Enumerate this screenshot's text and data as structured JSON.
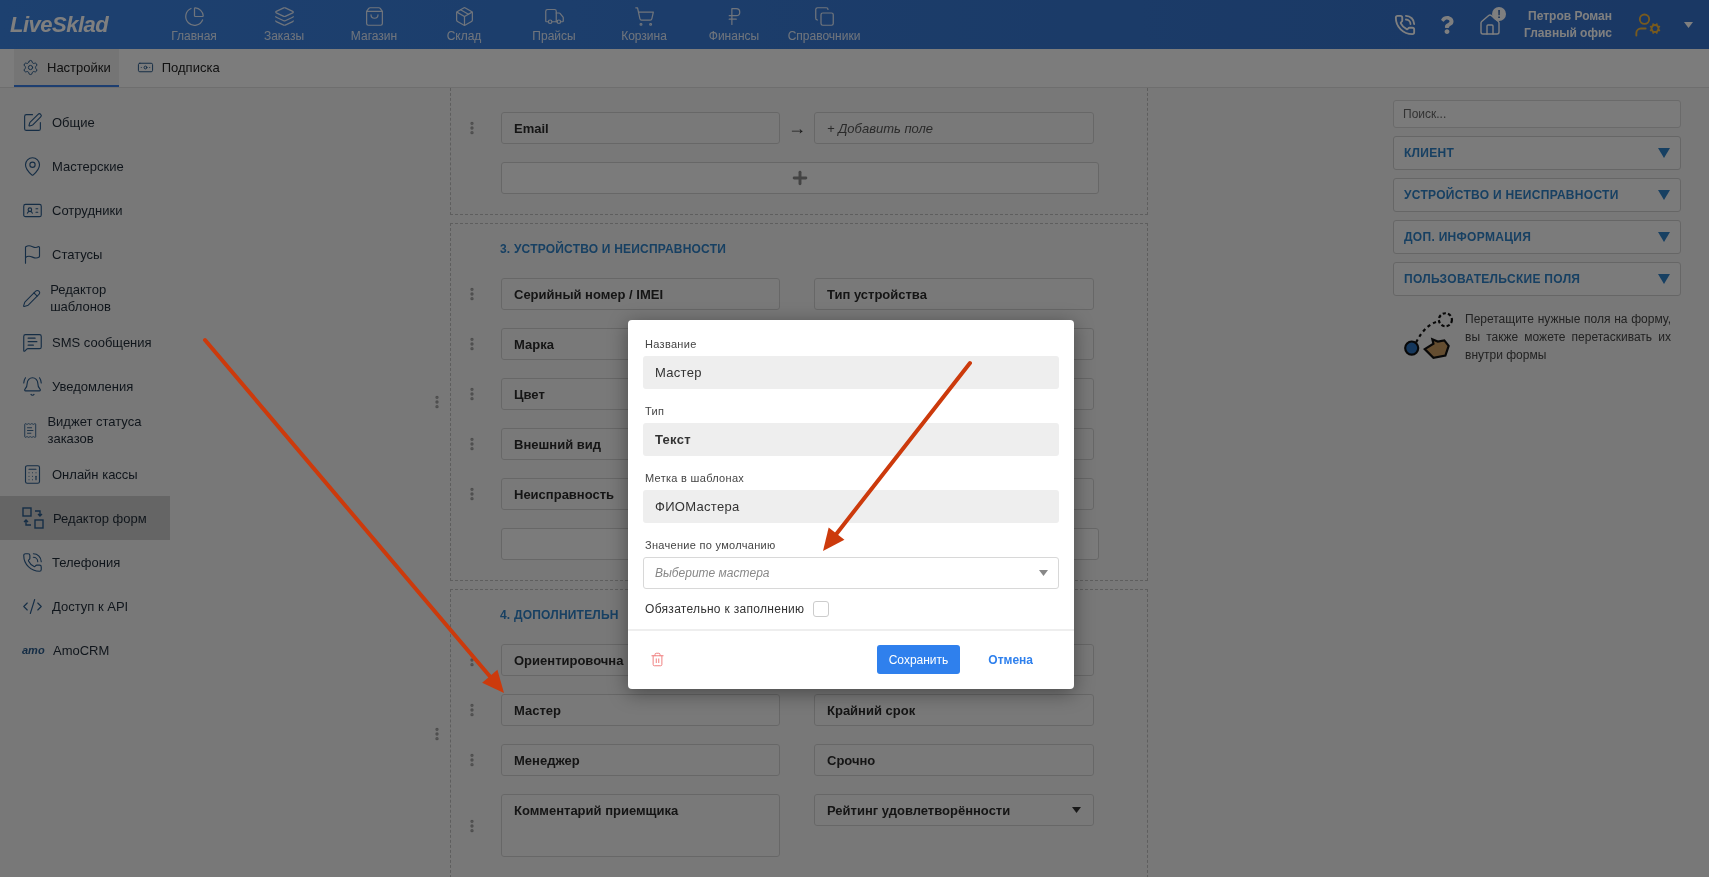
{
  "header": {
    "logo": "LiveSklad",
    "nav": [
      {
        "label": "Главная"
      },
      {
        "label": "Заказы"
      },
      {
        "label": "Магазин"
      },
      {
        "label": "Склад"
      },
      {
        "label": "Прайсы"
      },
      {
        "label": "Корзина"
      },
      {
        "label": "Финансы"
      },
      {
        "label": "Справочники"
      }
    ],
    "notification_badge": "!",
    "user": {
      "name": "Петров Роман",
      "office": "Главный офис"
    }
  },
  "subnav": [
    {
      "label": "Настройки",
      "selected": true
    },
    {
      "label": "Подписка",
      "selected": false
    }
  ],
  "sidebar": [
    {
      "label": "Общие",
      "selected": false
    },
    {
      "label": "Мастерские",
      "selected": false
    },
    {
      "label": "Сотрудники",
      "selected": false
    },
    {
      "label": "Статусы",
      "selected": false
    },
    {
      "label": "Редактор шаблонов",
      "selected": false
    },
    {
      "label": "SMS сообщения",
      "selected": false
    },
    {
      "label": "Уведомления",
      "selected": false
    },
    {
      "label": "Виджет статуса заказов",
      "selected": false
    },
    {
      "label": "Онлайн кассы",
      "selected": false
    },
    {
      "label": "Редактор форм",
      "selected": true
    },
    {
      "label": "Телефония",
      "selected": false
    },
    {
      "label": "Доступ к API",
      "selected": false
    },
    {
      "label": "AmoCRM",
      "selected": false,
      "logo": "amo"
    }
  ],
  "sections": [
    {
      "drag_handle": false,
      "rows": [
        {
          "kind": "text",
          "left": "Email",
          "connector": "→",
          "right_placeholder": "+ Добавить поле"
        }
      ],
      "add_bar": true,
      "add_bar_plus": true
    },
    {
      "drag_handle": true,
      "title": "3. УСТРОЙСТВО И НЕИСПРАВНОСТИ",
      "rows": [
        {
          "kind": "text",
          "left": "Серийный номер / IMEI",
          "right": "Тип устройства",
          "right_dropdown": false
        },
        {
          "kind": "text",
          "left": "Марка"
        },
        {
          "kind": "text",
          "left": "Цвет"
        },
        {
          "kind": "text",
          "left": "Внешний вид"
        },
        {
          "kind": "text",
          "left": "Неисправность"
        }
      ],
      "add_bar": true
    },
    {
      "drag_handle": true,
      "title": "4. ДОПОЛНИТЕЛЬН",
      "rows": [
        {
          "kind": "text",
          "left": "Ориентировочна"
        },
        {
          "kind": "text",
          "left": "Мастер",
          "right": "Крайний срок",
          "right_dropdown": false
        },
        {
          "kind": "text",
          "left": "Менеджер",
          "right": "Срочно",
          "right_dropdown": false
        },
        {
          "kind": "textarea",
          "left": "Комментарий приемщика",
          "right": "Рейтинг удовлетворённости",
          "right_dropdown": true
        }
      ]
    }
  ],
  "right_panel": {
    "search": {
      "placeholder": "Поиск..."
    },
    "groups": [
      {
        "title": "КЛИЕНТ"
      },
      {
        "title": "УСТРОЙСТВО И НЕИСПРАВНОСТИ"
      },
      {
        "title": "ДОП. ИНФОРМАЦИЯ"
      },
      {
        "title": "ПОЛЬЗОВАТЕЛЬСКИЕ ПОЛЯ"
      }
    ],
    "hint": "Перетащите нужные поля на форму, вы также можете перетаскивать их внутри формы"
  },
  "modal": {
    "fields": [
      {
        "kind": "input",
        "label": "Название",
        "value": "Мастер"
      },
      {
        "kind": "choice",
        "label": "Тип",
        "value": "Текст"
      },
      {
        "kind": "input",
        "label": "Метка в шаблонах",
        "value": "ФИОМастера"
      },
      {
        "kind": "select",
        "label": "Значение по умолчанию",
        "placeholder": "Выберите мастера"
      }
    ],
    "required": {
      "label": "Обязательно к заполнению",
      "checked": false
    },
    "save": "Сохранить",
    "cancel": "Отмена"
  }
}
